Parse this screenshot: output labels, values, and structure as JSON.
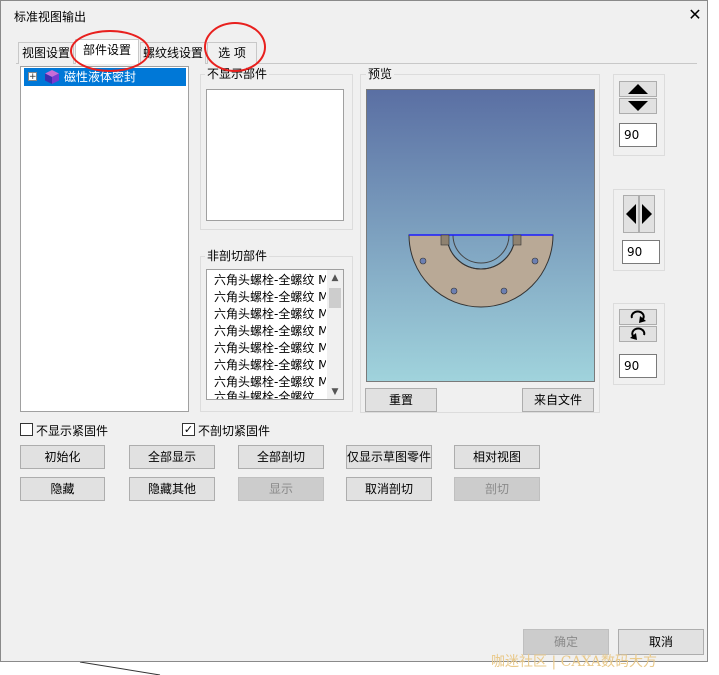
{
  "window": {
    "title": "标准视图输出",
    "close_glyph": "✕"
  },
  "tabs": [
    {
      "label": "视图设置"
    },
    {
      "label": "部件设置"
    },
    {
      "label": "螺纹线设置"
    },
    {
      "label": "选  项"
    }
  ],
  "tree": {
    "expander": "+",
    "item_label": "磁性液体密封",
    "icon": "cube-icon"
  },
  "hidden_parts": {
    "label": "不显示部件"
  },
  "non_section_parts": {
    "label": "非剖切部件",
    "items": [
      "六角头螺栓-全螺纹 M",
      "六角头螺栓-全螺纹 M",
      "六角头螺栓-全螺纹 M",
      "六角头螺栓-全螺纹 M",
      "六角头螺栓-全螺纹 M",
      "六角头螺栓-全螺纹 M",
      "六角头螺栓-全螺纹 M",
      "六角头螺栓-全螺纹"
    ]
  },
  "preview": {
    "label": "预览",
    "reset_label": "重置",
    "from_file_label": "来自文件"
  },
  "rotation": {
    "vertical_value": "90",
    "horizontal_value": "90",
    "roll_value": "90"
  },
  "checkboxes": [
    {
      "label": "不显示紧固件",
      "checked": false
    },
    {
      "label": "不剖切紧固件",
      "checked": true,
      "mark": "✓"
    }
  ],
  "buttons_row1": [
    "初始化",
    "全部显示",
    "全部剖切",
    "仅显示草图零件",
    "相对视图"
  ],
  "buttons_row2": [
    {
      "label": "隐藏",
      "enabled": true
    },
    {
      "label": "隐藏其他",
      "enabled": true
    },
    {
      "label": "显示",
      "enabled": false
    },
    {
      "label": "取消剖切",
      "enabled": true
    },
    {
      "label": "剖切",
      "enabled": false
    }
  ],
  "footer": {
    "ok_label": "确定",
    "cancel_label": "取消"
  },
  "watermark": {
    "text": "咖迷社区 | CAXA数码大方"
  },
  "colors": {
    "selection": "#0078d7",
    "annotation_circle": "#e8201e",
    "preview_top": "#5a6fa3",
    "preview_bottom": "#a0d3dc",
    "part_fill": "#b9a996"
  }
}
